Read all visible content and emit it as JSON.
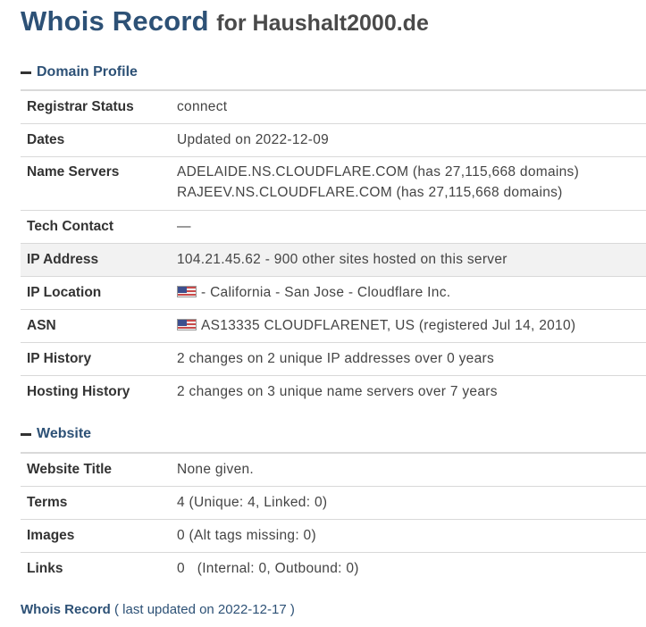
{
  "header": {
    "title": "Whois Record",
    "subtitle": "for Haushalt2000.de"
  },
  "domain_profile": {
    "heading": "Domain Profile",
    "registrar_status": {
      "label": "Registrar Status",
      "value": "connect"
    },
    "dates": {
      "label": "Dates",
      "value": "Updated on 2022-12-09"
    },
    "name_servers": {
      "label": "Name Servers",
      "values": [
        "ADELAIDE.NS.CLOUDFLARE.COM (has 27,115,668 domains)",
        "RAJEEV.NS.CLOUDFLARE.COM (has 27,115,668 domains)"
      ]
    },
    "tech_contact": {
      "label": "Tech Contact",
      "value": "—"
    },
    "ip_address": {
      "label": "IP Address",
      "value": "104.21.45.62 - 900 other sites hosted on this server"
    },
    "ip_location": {
      "label": "IP Location",
      "value": "- California - San Jose - Cloudflare Inc.",
      "flag_icon": "us-flag-icon"
    },
    "asn": {
      "label": "ASN",
      "value": "AS13335 CLOUDFLARENET, US (registered Jul 14, 2010)",
      "flag_icon": "us-flag-icon"
    },
    "ip_history": {
      "label": "IP History",
      "value": "2 changes on 2 unique IP addresses over 0 years"
    },
    "hosting_history": {
      "label": "Hosting History",
      "value": "2 changes on 3 unique name servers over 7 years"
    }
  },
  "website": {
    "heading": "Website",
    "title": {
      "label": "Website Title",
      "value": "None given."
    },
    "terms": {
      "label": "Terms",
      "value": "4 (Unique: 4, Linked: 0)"
    },
    "images": {
      "label": "Images",
      "value": "0 (Alt tags missing: 0)"
    },
    "links": {
      "label": "Links",
      "value": "0   (Internal: 0, Outbound: 0)"
    }
  },
  "footer": {
    "link_text": "Whois Record",
    "note": "( last updated on 2022-12-17 )"
  },
  "colors": {
    "accent": "#2d5176",
    "text": "#333333",
    "row_highlight": "#f2f2f2",
    "border": "#d9d9d9"
  }
}
